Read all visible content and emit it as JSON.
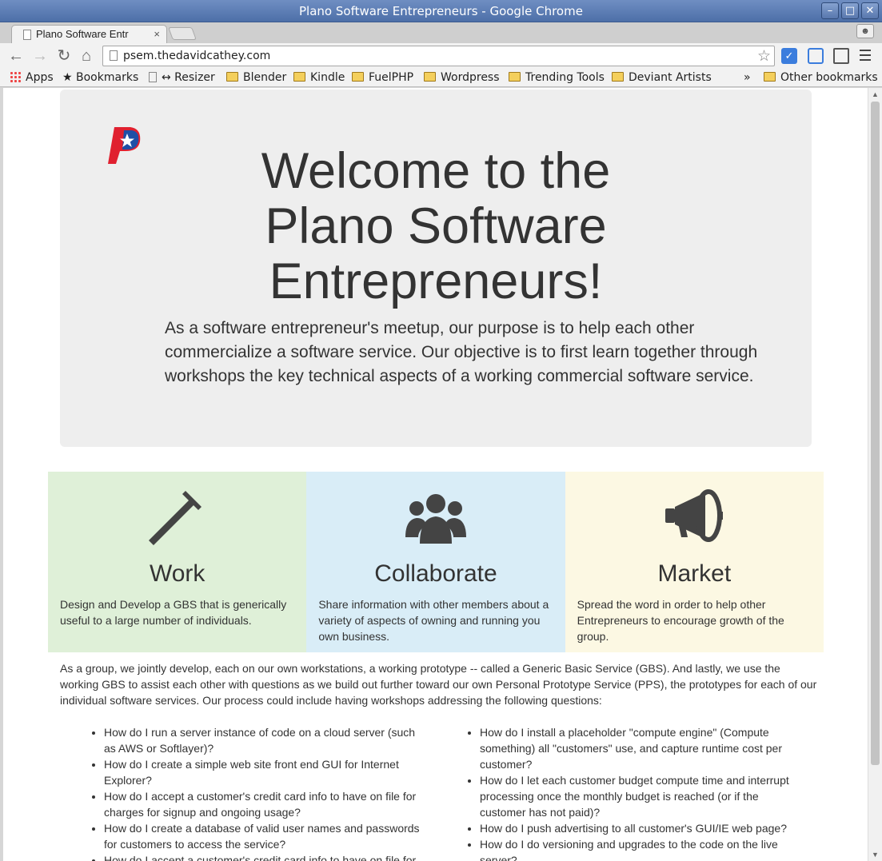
{
  "window": {
    "title": "Plano Software Entrepreneurs - Google Chrome",
    "minimize": "–",
    "maximize": "□",
    "close": "✕"
  },
  "tab": {
    "label": "Plano Software Entr",
    "close": "×"
  },
  "toolbar": {
    "url": "psem.thedavidcathey.com",
    "back_icon": "←",
    "forward_icon": "→",
    "reload_icon": "↻",
    "home_icon": "⌂",
    "star_icon": "☆"
  },
  "bookmarks": {
    "apps": "Apps",
    "bookmarks": "Bookmarks",
    "resizer": "↔ Resizer",
    "blender": "Blender",
    "kindle": "Kindle",
    "fuelphp": "FuelPHP",
    "wordpress": "Wordpress",
    "trending": "Trending Tools",
    "deviant": "Deviant Artists",
    "overflow": "»",
    "other": "Other bookmarks"
  },
  "hero": {
    "title_line1": "Welcome to the",
    "title_line2": "Plano Software",
    "title_line3": "Entrepreneurs!",
    "lead": "As a software entrepreneur's meetup, our purpose is to help each other commercialize a software service. Our objective is to first learn together through workshops the key technical aspects of a working commercial software service."
  },
  "features": {
    "work": {
      "title": "Work",
      "text": "Design and Develop a GBS that is generically useful to a large number of individuals.",
      "icon": "hammer-icon",
      "color": "#dff0d8"
    },
    "collaborate": {
      "title": "Collaborate",
      "text": "Share information with other members about a variety of aspects of owning and running you own business.",
      "icon": "group-icon",
      "color": "#d9edf7"
    },
    "market": {
      "title": "Market",
      "text": "Spread the word in order to help other Entrepreneurs to encourage growth of the group.",
      "icon": "bullhorn-icon",
      "color": "#fcf8e3"
    }
  },
  "intro": "As a group, we jointly develop, each on our own workstations, a working prototype -- called a Generic Basic Service (GBS). And lastly, we use the working GBS to assist each other with questions as we build out further toward our own Personal Prototype Service (PPS), the prototypes for each of our individual software services. Our process could include having workshops addressing the following questions:",
  "questions_left": [
    "How do I run a server instance of code on a cloud server (such as AWS or Softlayer)?",
    "How do I create a simple web site front end GUI for Internet Explorer?",
    "How do I accept a customer's credit card info to have on file for charges for signup and ongoing usage?",
    "How do I create a database of valid user names and passwords for customers to access the service?",
    "How do I accept a customer's credit card info to have on file for"
  ],
  "questions_right": [
    "How do I install a placeholder \"compute engine\" (Compute something) all \"customers\" use, and capture runtime cost per customer?",
    "How do I let each customer budget compute time and interrupt processing once the monthly budget is reached (or if the customer has not paid)?",
    "How do I push advertising to all customer's GUI/IE web page?",
    "How do I do versioning and upgrades to the code on the live server?"
  ],
  "colors": {
    "titlebar": "#5579b4",
    "logo_red": "#e0202f",
    "logo_blue": "#1f4fa6",
    "icon_dark": "#444444"
  }
}
